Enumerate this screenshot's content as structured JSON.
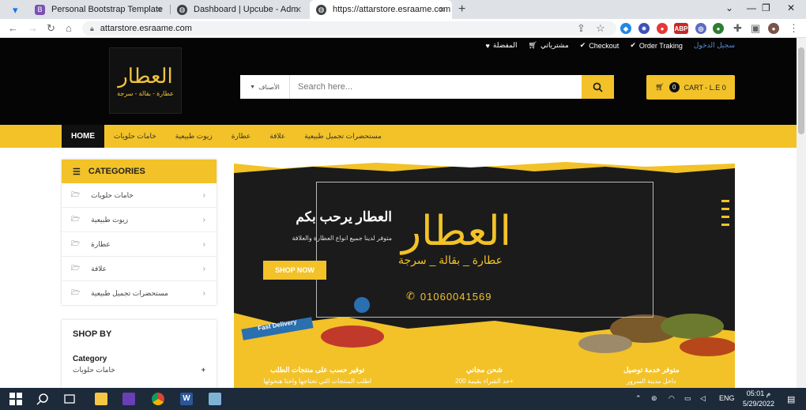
{
  "browser": {
    "tabs": [
      {
        "title": "Personal Bootstrap Template",
        "active": false
      },
      {
        "title": "Dashboard | Upcube - Admin & D",
        "active": false
      },
      {
        "title": "https://attarstore.esraame.com",
        "active": true
      }
    ],
    "url": "attarstore.esraame.com"
  },
  "header": {
    "toplinks": {
      "login": "سجيل الدخول",
      "order_tracking": "Order Traking",
      "checkout": "Checkout",
      "purchases": "مشترياتي",
      "favorites": "المفضلة"
    },
    "logo": {
      "name": "العطار",
      "tagline": "عطارة - بقالة - سرجة"
    },
    "search": {
      "category": "الأصناف",
      "placeholder": "Search here..."
    },
    "cart": {
      "count": "0",
      "label": "CART - L.E 0"
    }
  },
  "nav": {
    "items": [
      "HOME",
      "خامات حلويات",
      "زيوت طبيعية",
      "عطارة",
      "علافة",
      "مستحضرات تجميل طبيعية"
    ]
  },
  "sidebar": {
    "categories_title": "CATEGORIES",
    "categories": [
      "خامات حلويات",
      "زيوت طبيعية",
      "عطارة",
      "علافة",
      "مستحضرات تجميل طبيعية"
    ],
    "shopby_title": "SHOP BY",
    "category_heading": "Category",
    "shopby_items": [
      "خامات حلويات"
    ]
  },
  "banner": {
    "title": "العطار يرحب بكم",
    "subtitle": "متوفر لدينا جميع انواع العطارة والعلافة",
    "button": "SHOP NOW",
    "brand": "العطار",
    "brand_tagline": "عطارة _ بقالة _ سرجة",
    "phone": "01060041569",
    "delivery_tag": "Fast Delivery"
  },
  "features": [
    {
      "title": "توفير حسب على منتجات الطلب",
      "desc": "اطلب المنتجات التي تحتاجها واحنا هنحولها"
    },
    {
      "title": "شحن مجاني",
      "desc": "+حد الشراء بقيمة 200"
    },
    {
      "title": "متوفر خدمة توصيل",
      "desc": "داخل مدينة السرور"
    }
  ],
  "taskbar": {
    "lang": "ENG",
    "time": "05:01 م",
    "date": "5/29/2022"
  },
  "colors": {
    "accent": "#f2c228",
    "header_bg": "#050505"
  }
}
